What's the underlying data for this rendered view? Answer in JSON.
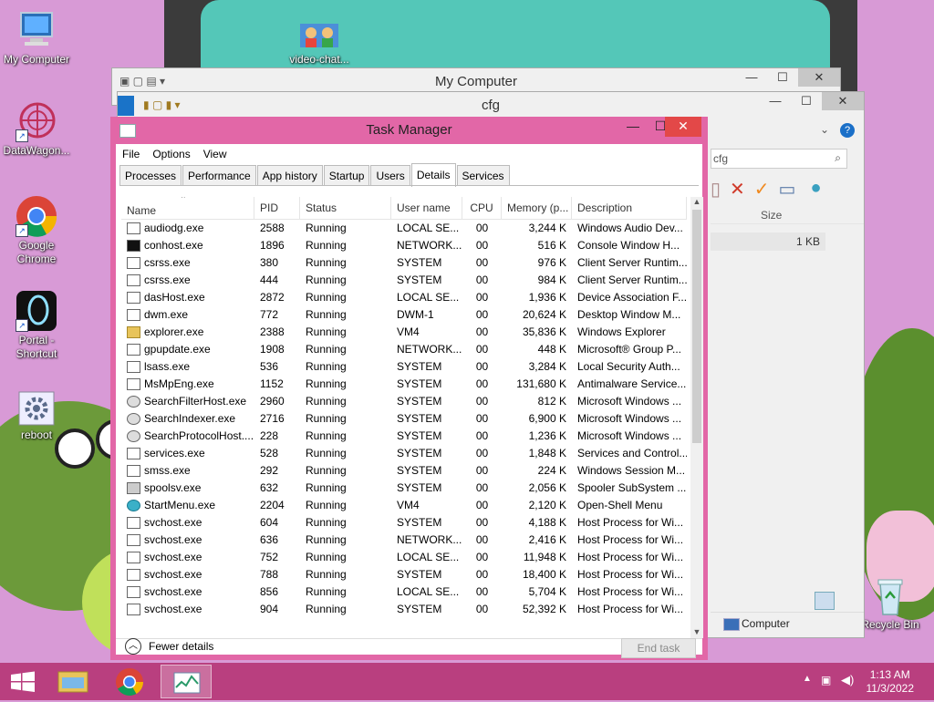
{
  "desktop": {
    "icons": [
      {
        "label": "My Computer"
      },
      {
        "label": "video-chat..."
      },
      {
        "label": "DataWagon..."
      },
      {
        "label": "Google Chrome"
      },
      {
        "label": "Portal - Shortcut"
      },
      {
        "label": "reboot"
      },
      {
        "label": "Recycle Bin"
      }
    ]
  },
  "back_window": {
    "title": "My Computer"
  },
  "mid_window": {
    "title": "cfg",
    "search_placeholder": "cfg",
    "column_size": "Size",
    "file_size": "1 KB",
    "status_location": "Computer"
  },
  "task_manager": {
    "title": "Task Manager",
    "menu": [
      "File",
      "Options",
      "View"
    ],
    "tabs": [
      "Processes",
      "Performance",
      "App history",
      "Startup",
      "Users",
      "Details",
      "Services"
    ],
    "active_tab": "Details",
    "columns": [
      "Name",
      "PID",
      "Status",
      "User name",
      "CPU",
      "Memory (p...",
      "Description"
    ],
    "rows": [
      {
        "icon": "window",
        "name": "audiodg.exe",
        "pid": "2588",
        "status": "Running",
        "user": "LOCAL SE...",
        "cpu": "00",
        "mem": "3,244 K",
        "desc": "Windows Audio Dev..."
      },
      {
        "icon": "console",
        "name": "conhost.exe",
        "pid": "1896",
        "status": "Running",
        "user": "NETWORK...",
        "cpu": "00",
        "mem": "516 K",
        "desc": "Console Window H..."
      },
      {
        "icon": "window",
        "name": "csrss.exe",
        "pid": "380",
        "status": "Running",
        "user": "SYSTEM",
        "cpu": "00",
        "mem": "976 K",
        "desc": "Client Server Runtim..."
      },
      {
        "icon": "window",
        "name": "csrss.exe",
        "pid": "444",
        "status": "Running",
        "user": "SYSTEM",
        "cpu": "00",
        "mem": "984 K",
        "desc": "Client Server Runtim..."
      },
      {
        "icon": "window",
        "name": "dasHost.exe",
        "pid": "2872",
        "status": "Running",
        "user": "LOCAL SE...",
        "cpu": "00",
        "mem": "1,936 K",
        "desc": "Device Association F..."
      },
      {
        "icon": "window",
        "name": "dwm.exe",
        "pid": "772",
        "status": "Running",
        "user": "DWM-1",
        "cpu": "00",
        "mem": "20,624 K",
        "desc": "Desktop Window M..."
      },
      {
        "icon": "folder",
        "name": "explorer.exe",
        "pid": "2388",
        "status": "Running",
        "user": "VM4",
        "cpu": "00",
        "mem": "35,836 K",
        "desc": "Windows Explorer"
      },
      {
        "icon": "window",
        "name": "gpupdate.exe",
        "pid": "1908",
        "status": "Running",
        "user": "NETWORK...",
        "cpu": "00",
        "mem": "448 K",
        "desc": "Microsoft® Group P..."
      },
      {
        "icon": "window",
        "name": "lsass.exe",
        "pid": "536",
        "status": "Running",
        "user": "SYSTEM",
        "cpu": "00",
        "mem": "3,284 K",
        "desc": "Local Security Auth..."
      },
      {
        "icon": "window",
        "name": "MsMpEng.exe",
        "pid": "1152",
        "status": "Running",
        "user": "SYSTEM",
        "cpu": "00",
        "mem": "131,680 K",
        "desc": "Antimalware Service..."
      },
      {
        "icon": "user",
        "name": "SearchFilterHost.exe",
        "pid": "2960",
        "status": "Running",
        "user": "SYSTEM",
        "cpu": "00",
        "mem": "812 K",
        "desc": "Microsoft Windows ..."
      },
      {
        "icon": "user",
        "name": "SearchIndexer.exe",
        "pid": "2716",
        "status": "Running",
        "user": "SYSTEM",
        "cpu": "00",
        "mem": "6,900 K",
        "desc": "Microsoft Windows ..."
      },
      {
        "icon": "user",
        "name": "SearchProtocolHost....",
        "pid": "228",
        "status": "Running",
        "user": "SYSTEM",
        "cpu": "00",
        "mem": "1,236 K",
        "desc": "Microsoft Windows ..."
      },
      {
        "icon": "window",
        "name": "services.exe",
        "pid": "528",
        "status": "Running",
        "user": "SYSTEM",
        "cpu": "00",
        "mem": "1,848 K",
        "desc": "Services and Control..."
      },
      {
        "icon": "window",
        "name": "smss.exe",
        "pid": "292",
        "status": "Running",
        "user": "SYSTEM",
        "cpu": "00",
        "mem": "224 K",
        "desc": "Windows Session M..."
      },
      {
        "icon": "printer",
        "name": "spoolsv.exe",
        "pid": "632",
        "status": "Running",
        "user": "SYSTEM",
        "cpu": "00",
        "mem": "2,056 K",
        "desc": "Spooler SubSystem ..."
      },
      {
        "icon": "shell",
        "name": "StartMenu.exe",
        "pid": "2204",
        "status": "Running",
        "user": "VM4",
        "cpu": "00",
        "mem": "2,120 K",
        "desc": "Open-Shell Menu"
      },
      {
        "icon": "window",
        "name": "svchost.exe",
        "pid": "604",
        "status": "Running",
        "user": "SYSTEM",
        "cpu": "00",
        "mem": "4,188 K",
        "desc": "Host Process for Wi..."
      },
      {
        "icon": "window",
        "name": "svchost.exe",
        "pid": "636",
        "status": "Running",
        "user": "NETWORK...",
        "cpu": "00",
        "mem": "2,416 K",
        "desc": "Host Process for Wi..."
      },
      {
        "icon": "window",
        "name": "svchost.exe",
        "pid": "752",
        "status": "Running",
        "user": "LOCAL SE...",
        "cpu": "00",
        "mem": "11,948 K",
        "desc": "Host Process for Wi..."
      },
      {
        "icon": "window",
        "name": "svchost.exe",
        "pid": "788",
        "status": "Running",
        "user": "SYSTEM",
        "cpu": "00",
        "mem": "18,400 K",
        "desc": "Host Process for Wi..."
      },
      {
        "icon": "window",
        "name": "svchost.exe",
        "pid": "856",
        "status": "Running",
        "user": "LOCAL SE...",
        "cpu": "00",
        "mem": "5,704 K",
        "desc": "Host Process for Wi..."
      },
      {
        "icon": "window",
        "name": "svchost.exe",
        "pid": "904",
        "status": "Running",
        "user": "SYSTEM",
        "cpu": "00",
        "mem": "52,392 K",
        "desc": "Host Process for Wi..."
      }
    ],
    "fewer_details": "Fewer details",
    "end_task": "End task"
  },
  "taskbar": {
    "time": "1:13 AM",
    "date": "11/3/2022"
  },
  "colors": {
    "accent": "#e267a7",
    "taskbar": "#b93f7f",
    "close": "#e34848"
  }
}
